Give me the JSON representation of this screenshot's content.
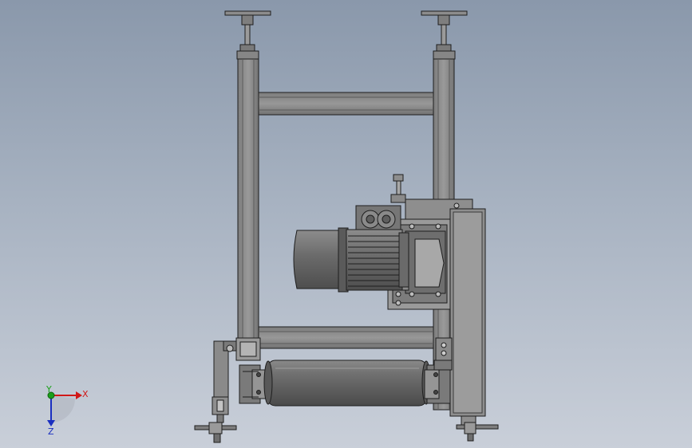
{
  "viewport": {
    "background_top": "#8a98ab",
    "background_bottom": "#c9cfd9"
  },
  "triad": {
    "x_label": "X",
    "y_label": "Y",
    "z_label": "Z",
    "x_color": "#d01818",
    "y_color": "#1aa01a",
    "z_color": "#1a2fc0"
  },
  "model": {
    "frame_color": "#8a8a8a",
    "motor_color": "#6e6e6e",
    "roller_color": "#6a6a6a",
    "outline_color": "#1e1e1e"
  }
}
